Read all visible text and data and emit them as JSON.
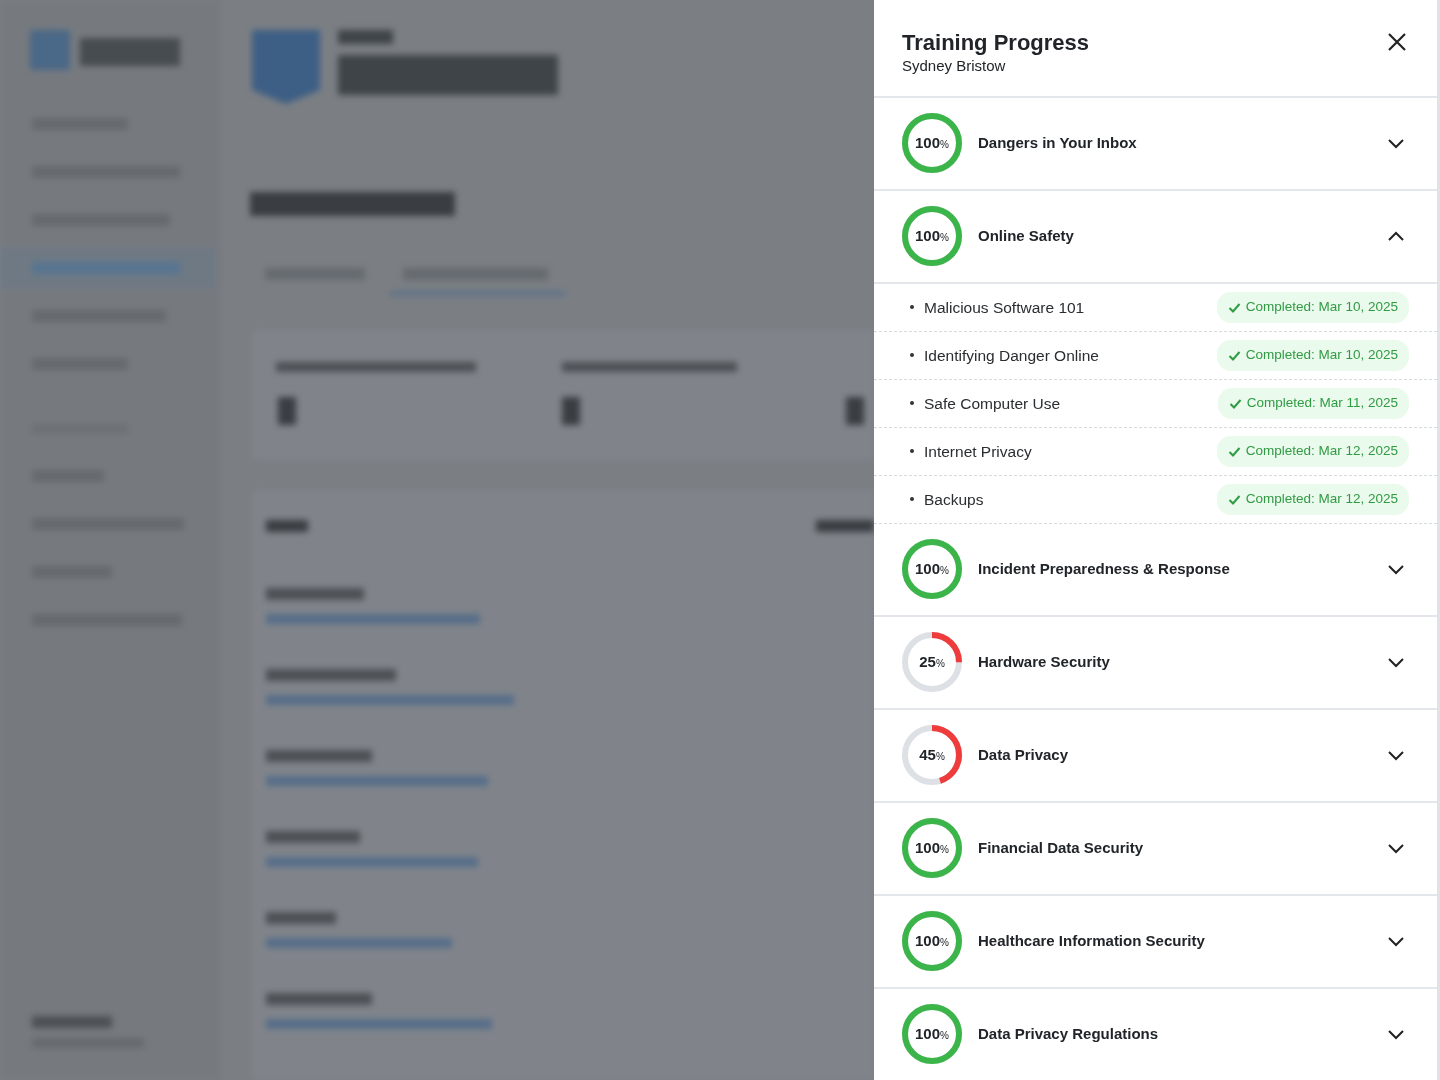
{
  "panel": {
    "title": "Training Progress",
    "subtitle": "Sydney Bristow"
  },
  "courses": [
    {
      "name": "Dangers in Your Inbox",
      "percent": "100",
      "unit": "%",
      "level": 1,
      "expanded": false
    },
    {
      "name": "Online Safety",
      "percent": "100",
      "unit": "%",
      "level": 1,
      "expanded": true,
      "lessons": [
        {
          "name": "Malicious Software 101",
          "status": "Completed: Mar 10, 2025"
        },
        {
          "name": "Identifying Danger Online",
          "status": "Completed: Mar 10, 2025"
        },
        {
          "name": "Safe Computer Use",
          "status": "Completed: Mar 11, 2025"
        },
        {
          "name": "Internet Privacy",
          "status": "Completed: Mar 12, 2025"
        },
        {
          "name": "Backups",
          "status": "Completed: Mar 12, 2025"
        }
      ]
    },
    {
      "name": "Incident Preparedness & Response",
      "percent": "100",
      "unit": "%",
      "level": 1,
      "expanded": false
    },
    {
      "name": "Hardware Security",
      "percent": "25",
      "unit": "%",
      "level": 0.25,
      "expanded": false
    },
    {
      "name": "Data Privacy",
      "percent": "45",
      "unit": "%",
      "level": 0.45,
      "expanded": false
    },
    {
      "name": "Financial Data Security",
      "percent": "100",
      "unit": "%",
      "level": 1,
      "expanded": false
    },
    {
      "name": "Healthcare Information Security",
      "percent": "100",
      "unit": "%",
      "level": 1,
      "expanded": false
    },
    {
      "name": "Data Privacy Regulations",
      "percent": "100",
      "unit": "%",
      "level": 1,
      "expanded": false
    }
  ]
}
